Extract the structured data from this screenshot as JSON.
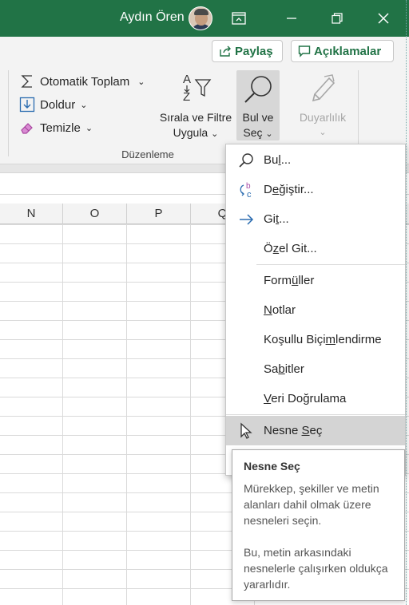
{
  "titlebar": {
    "user_name": "Aydın Ören",
    "bg_color": "#217346",
    "icons": [
      "user-avatar",
      "ribbon-display-icon",
      "minimize-icon",
      "restore-icon",
      "close-icon"
    ]
  },
  "ribbon": {
    "share_label": "Paylaş",
    "comments_label": "Açıklamalar",
    "autosum_label": "Otomatik Toplam",
    "fill_label": "Doldur",
    "clear_label": "Temizle",
    "sort_filter_line1": "Sırala ve Filtre",
    "sort_filter_line2": "Uygula",
    "find_select_line1": "Bul ve",
    "find_select_line2": "Seç",
    "sensitivity_label": "Duyarlılık",
    "group_label": "Düzenleme"
  },
  "sheet": {
    "columns": [
      "N",
      "O",
      "P",
      "Q"
    ]
  },
  "menu": {
    "items": [
      {
        "pre": "Bu",
        "u": "l",
        "post": "...",
        "icon": "search-icon"
      },
      {
        "pre": "D",
        "u": "e",
        "post": "ğiştir...",
        "icon": "replace-icon"
      },
      {
        "pre": "Gi",
        "u": "t",
        "post": "...",
        "icon": "arrow-right-icon"
      },
      {
        "pre": "Ö",
        "u": "z",
        "post": "el Git...",
        "icon": ""
      },
      {
        "pre": "Form",
        "u": "ü",
        "post": "ller",
        "icon": ""
      },
      {
        "pre": "",
        "u": "N",
        "post": "otlar",
        "icon": ""
      },
      {
        "pre": "Koşullu Biçi",
        "u": "m",
        "post": "lendirme",
        "icon": ""
      },
      {
        "pre": "Sa",
        "u": "b",
        "post": "itler",
        "icon": ""
      },
      {
        "pre": "",
        "u": "V",
        "post": "eri Doğrulama",
        "icon": ""
      },
      {
        "pre": "Nesne ",
        "u": "S",
        "post": "eç",
        "icon": "pointer-icon"
      }
    ]
  },
  "tooltip": {
    "title": "Nesne Seç",
    "para1": "Mürekkep, şekiller ve metin alanları dahil olmak üzere nesneleri seçin.",
    "para2": "Bu, metin arkasındaki nesnelerle çalışırken oldukça yararlıdır."
  }
}
